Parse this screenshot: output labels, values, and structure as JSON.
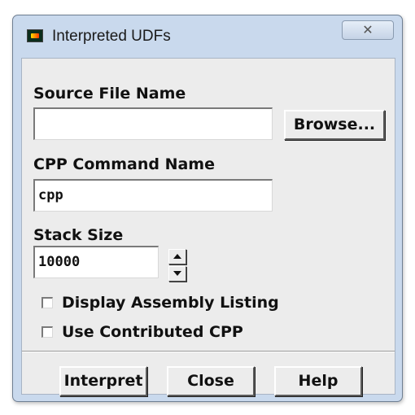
{
  "window": {
    "title": "Interpreted UDFs",
    "close_glyph": "✕"
  },
  "source_file": {
    "label": "Source File Name",
    "value": "",
    "browse_label": "Browse..."
  },
  "cpp_command": {
    "label": "CPP Command Name",
    "value": "cpp"
  },
  "stack_size": {
    "label": "Stack Size",
    "value": "10000"
  },
  "options": {
    "display_assembly": {
      "label": "Display Assembly Listing",
      "checked": false
    },
    "use_contributed_cpp": {
      "label": "Use Contributed CPP",
      "checked": false
    }
  },
  "buttons": {
    "interpret": "Interpret",
    "close": "Close",
    "help": "Help"
  },
  "icons": {
    "app": "fluent-app-icon",
    "close": "close-icon",
    "spin_up": "spin-up-arrow-icon",
    "spin_down": "spin-down-arrow-icon"
  },
  "colors": {
    "frame": "#c9d9ed",
    "panel": "#ececec"
  }
}
